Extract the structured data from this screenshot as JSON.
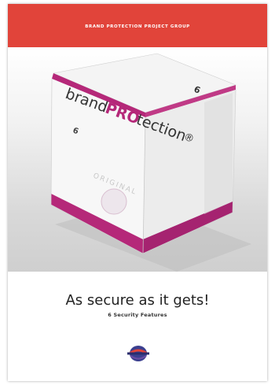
{
  "header": {
    "title": "BRAND PROTECTION PROJECT GROUP",
    "color": "#e1443a"
  },
  "product": {
    "brand_prefix": "brand",
    "brand_highlight": "PRO",
    "brand_suffix": "tection",
    "mark": "®",
    "count_label": "6",
    "side_label": "ORIGINAL",
    "accent_color": "#b52879"
  },
  "main": {
    "headline": "As secure as it gets!",
    "subline": "6 Security Features"
  },
  "footer": {
    "logo": "globe-logo-icon"
  }
}
